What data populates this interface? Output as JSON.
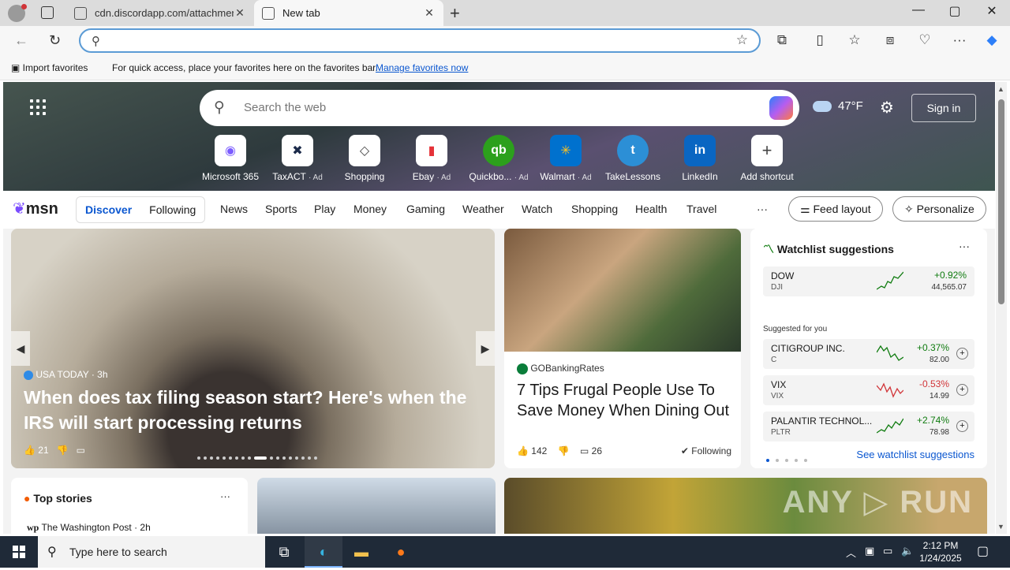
{
  "tabs": [
    {
      "title": "cdn.discordapp.com/attachments",
      "close": "✕"
    },
    {
      "title": "New tab",
      "close": "✕"
    }
  ],
  "newtab_label": "+",
  "window_controls": [
    "—",
    "▢",
    "✕"
  ],
  "address_bar": {
    "value": "",
    "placeholder": ""
  },
  "favorites_bar": {
    "import_label": "Import favorites",
    "message": "For quick access, place your favorites here on the favorites bar.",
    "link": "Manage favorites now"
  },
  "ntp": {
    "search_placeholder": "Search the web",
    "temperature": "47°F",
    "signin_label": "Sign in",
    "shortcuts": [
      {
        "label": "Microsoft 365",
        "ad": "",
        "glyph": "◉",
        "color": "#7b5cff"
      },
      {
        "label": "TaxACT",
        "ad": "· Ad",
        "glyph": "✖",
        "color": "#1b2a4a"
      },
      {
        "label": "Shopping",
        "ad": "",
        "glyph": "◇",
        "color": "#444"
      },
      {
        "label": "Ebay",
        "ad": "· Ad",
        "glyph": "▮",
        "color": "#e53238"
      },
      {
        "label": "Quickbo...",
        "ad": "· Ad",
        "glyph": "qb",
        "color": "#2ca01c"
      },
      {
        "label": "Walmart",
        "ad": "· Ad",
        "glyph": "✳",
        "color": "#0071ce"
      },
      {
        "label": "TakeLessons",
        "ad": "",
        "glyph": "t",
        "color": "#2c8fd6"
      },
      {
        "label": "LinkedIn",
        "ad": "",
        "glyph": "in",
        "color": "#0a66c2"
      },
      {
        "label": "Add shortcut",
        "ad": "",
        "glyph": "+",
        "color": "#444"
      }
    ]
  },
  "msn": {
    "logo": "msn",
    "feed_tabs": [
      "Discover",
      "Following"
    ],
    "categories": [
      "News",
      "Sports",
      "Play",
      "Money",
      "Gaming",
      "Weather",
      "Watch",
      "Shopping",
      "Health",
      "Travel"
    ],
    "more": "···",
    "feed_layout": "Feed layout",
    "personalize": "Personalize"
  },
  "main_story": {
    "source": "USA TODAY",
    "age": "· 3h",
    "headline": "When does tax filing season start? Here's when the IRS will start processing returns",
    "likes": "21"
  },
  "food_story": {
    "source": "GOBankingRates",
    "headline": "7 Tips Frugal People Use To Save Money When Dining Out",
    "likes": "142",
    "comments": "26",
    "following": "Following"
  },
  "watchlist": {
    "title": "Watchlist suggestions",
    "more": "···",
    "suggested_label": "Suggested for you",
    "see_more": "See watchlist suggestions",
    "items": [
      {
        "name": "DOW",
        "symbol": "DJI",
        "change": "+0.92%",
        "price": "44,565.07",
        "dir": "up"
      },
      {
        "name": "CITIGROUP INC.",
        "symbol": "C",
        "change": "+0.37%",
        "price": "82.00",
        "dir": "up"
      },
      {
        "name": "VIX",
        "symbol": "VIX",
        "change": "-0.53%",
        "price": "14.99",
        "dir": "down"
      },
      {
        "name": "PALANTIR TECHNOL...",
        "symbol": "PLTR",
        "change": "+2.74%",
        "price": "78.98",
        "dir": "up"
      }
    ]
  },
  "top_stories": {
    "title": "Top stories",
    "more": "···",
    "source": "The Washington Post · 2h"
  },
  "watermark": "ANY ▷ RUN",
  "taskbar": {
    "search_placeholder": "Type here to search",
    "time": "2:12 PM",
    "date": "1/24/2025"
  }
}
